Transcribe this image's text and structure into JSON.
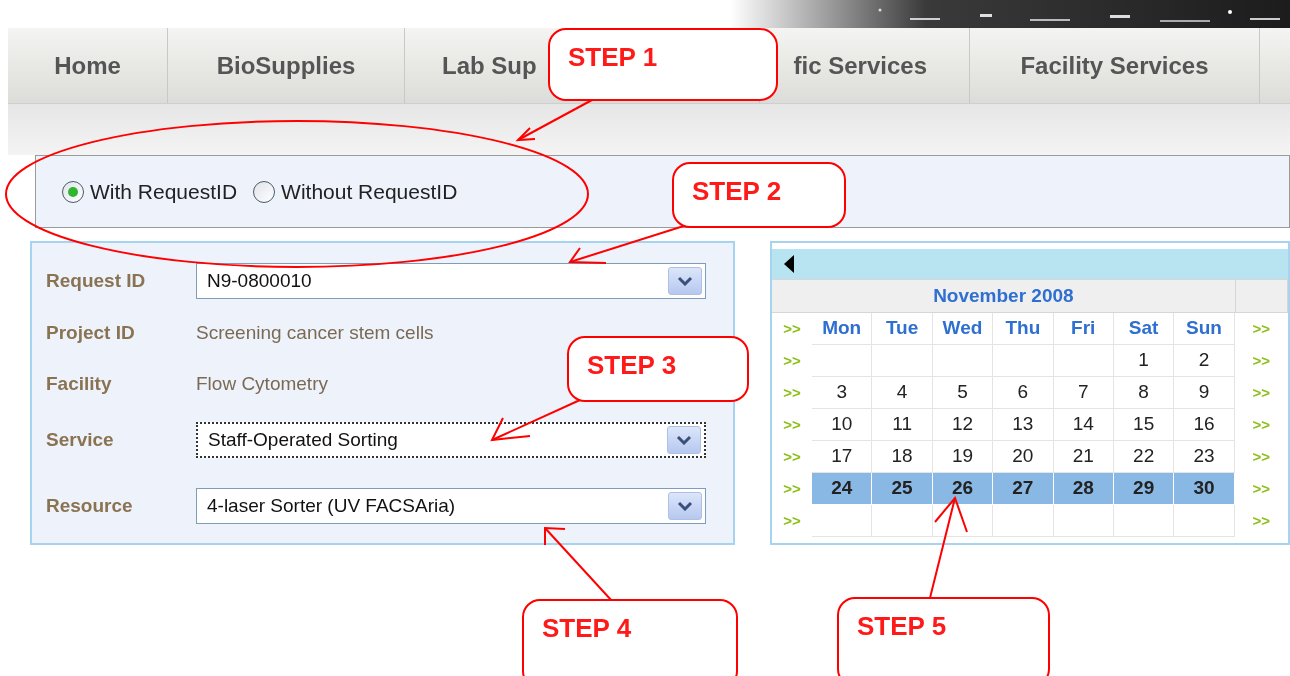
{
  "nav": {
    "tabs": [
      {
        "label": "Home"
      },
      {
        "label": "BioSupplies"
      },
      {
        "label": "Lab Sup"
      },
      {
        "label": "fic Services"
      },
      {
        "label": "Facility Services"
      }
    ]
  },
  "request_mode": {
    "options": [
      {
        "label": "With RequestID",
        "selected": true
      },
      {
        "label": "Without RequestID",
        "selected": false
      }
    ]
  },
  "form": {
    "fields": [
      {
        "label": "Request ID",
        "kind": "select",
        "value": "N9-0800010",
        "focused": false
      },
      {
        "label": "Project ID",
        "kind": "text",
        "value": "Screening cancer stem cells"
      },
      {
        "label": "Facility",
        "kind": "text",
        "value": "Flow Cytometry"
      },
      {
        "label": "Service",
        "kind": "select",
        "value": "Staff-Operated Sorting",
        "focused": true
      },
      {
        "label": "Resource",
        "kind": "select",
        "value": "4-laser Sorter (UV FACSAria)",
        "focused": false
      }
    ]
  },
  "calendar": {
    "month": "November 2008",
    "header": {
      "left": ">>",
      "days": [
        "Mon",
        "Tue",
        "Wed",
        "Thu",
        "Fri",
        "Sat",
        "Sun"
      ],
      "right": ">>"
    },
    "weeks": [
      {
        "left": ">>",
        "days": [
          {
            "kind": "empty"
          },
          {
            "kind": "empty"
          },
          {
            "kind": "empty"
          },
          {
            "kind": "empty"
          },
          {
            "kind": "empty"
          },
          {
            "kind": "day",
            "date": "1"
          },
          {
            "kind": "day",
            "date": "2"
          }
        ],
        "right": ">>",
        "selected": false
      },
      {
        "left": ">>",
        "days": [
          {
            "kind": "day",
            "date": "3"
          },
          {
            "kind": "day",
            "date": "4"
          },
          {
            "kind": "day",
            "date": "5"
          },
          {
            "kind": "day",
            "date": "6"
          },
          {
            "kind": "day",
            "date": "7"
          },
          {
            "kind": "day",
            "date": "8"
          },
          {
            "kind": "day",
            "date": "9"
          }
        ],
        "right": ">>",
        "selected": false
      },
      {
        "left": ">>",
        "days": [
          {
            "kind": "day",
            "date": "10"
          },
          {
            "kind": "day",
            "date": "11"
          },
          {
            "kind": "day",
            "date": "12"
          },
          {
            "kind": "day",
            "date": "13"
          },
          {
            "kind": "day",
            "date": "14"
          },
          {
            "kind": "day",
            "date": "15"
          },
          {
            "kind": "day",
            "date": "16"
          }
        ],
        "right": ">>",
        "selected": false
      },
      {
        "left": ">>",
        "days": [
          {
            "kind": "day",
            "date": "17"
          },
          {
            "kind": "day",
            "date": "18"
          },
          {
            "kind": "day",
            "date": "19"
          },
          {
            "kind": "day",
            "date": "20"
          },
          {
            "kind": "day",
            "date": "21"
          },
          {
            "kind": "day",
            "date": "22"
          },
          {
            "kind": "day",
            "date": "23"
          }
        ],
        "right": ">>",
        "selected": false
      },
      {
        "left": ">>",
        "days": [
          {
            "kind": "day",
            "date": "24"
          },
          {
            "kind": "day",
            "date": "25"
          },
          {
            "kind": "day",
            "date": "26"
          },
          {
            "kind": "day",
            "date": "27"
          },
          {
            "kind": "day",
            "date": "28"
          },
          {
            "kind": "day",
            "date": "29"
          },
          {
            "kind": "day",
            "date": "30"
          }
        ],
        "right": ">>",
        "selected": true
      },
      {
        "left": ">>",
        "days": [
          {
            "kind": "empty"
          },
          {
            "kind": "empty"
          },
          {
            "kind": "empty"
          },
          {
            "kind": "empty"
          },
          {
            "kind": "empty"
          },
          {
            "kind": "empty"
          },
          {
            "kind": "empty"
          }
        ],
        "right": ">>",
        "selected": false
      }
    ]
  },
  "annotations": [
    {
      "label": "STEP 1"
    },
    {
      "label": "STEP 2"
    },
    {
      "label": "STEP 3"
    },
    {
      "label": "STEP 4"
    },
    {
      "label": "STEP 5"
    }
  ]
}
